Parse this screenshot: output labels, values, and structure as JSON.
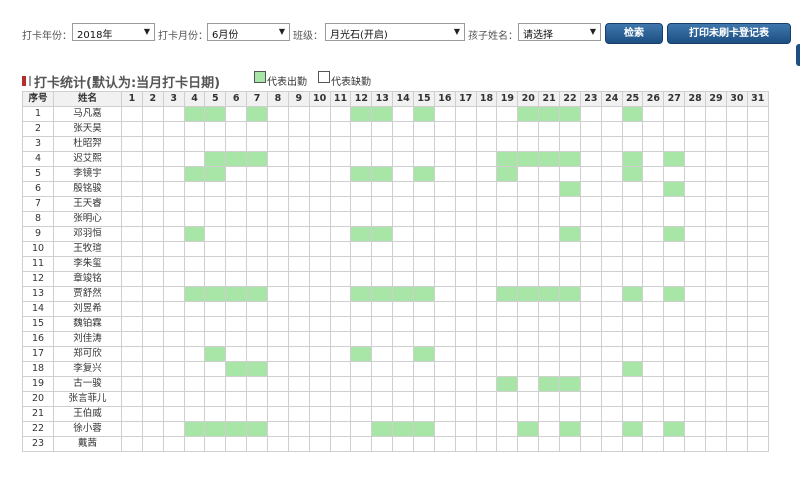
{
  "toolbar": {
    "year_label": "打卡年份：",
    "year_value": "2018年",
    "month_label": "打卡月份：",
    "month_value": "6月份",
    "class_label": "班级：",
    "class_value": "月光石(开启)",
    "child_label": "孩子姓名：",
    "child_value": "请选择",
    "search_button": "检索",
    "print_button": "打印未刷卡登记表"
  },
  "section": {
    "title": "打卡统计(默认为:当月打卡日期)",
    "legend_present": "代表出勤",
    "legend_absent": "代表缺勤",
    "present_color": "#a8e6a8",
    "absent_color": "#ffffff"
  },
  "table": {
    "header_no": "序号",
    "header_name": "姓名",
    "days": [
      "1",
      "2",
      "3",
      "4",
      "5",
      "6",
      "7",
      "8",
      "9",
      "10",
      "11",
      "12",
      "13",
      "14",
      "15",
      "16",
      "17",
      "18",
      "19",
      "20",
      "21",
      "22",
      "23",
      "24",
      "25",
      "26",
      "27",
      "28",
      "29",
      "30",
      "31"
    ],
    "rows": [
      {
        "no": "1",
        "name": "马凡嘉",
        "present": [
          4,
          5,
          7,
          12,
          13,
          15,
          20,
          21,
          22,
          25
        ]
      },
      {
        "no": "2",
        "name": "张天昊",
        "present": []
      },
      {
        "no": "3",
        "name": "杜昭羿",
        "present": []
      },
      {
        "no": "4",
        "name": "迟艾熙",
        "present": [
          5,
          6,
          7,
          19,
          20,
          21,
          22,
          25,
          27
        ]
      },
      {
        "no": "5",
        "name": "李镜宇",
        "present": [
          4,
          5,
          12,
          13,
          15,
          19,
          25
        ]
      },
      {
        "no": "6",
        "name": "殷铭骏",
        "present": [
          22,
          27
        ]
      },
      {
        "no": "7",
        "name": "王天睿",
        "present": []
      },
      {
        "no": "8",
        "name": "张明心",
        "present": []
      },
      {
        "no": "9",
        "name": "邓羽恒",
        "present": [
          4,
          12,
          13,
          22,
          27
        ]
      },
      {
        "no": "10",
        "name": "王牧瑄",
        "present": []
      },
      {
        "no": "11",
        "name": "李朱玺",
        "present": []
      },
      {
        "no": "12",
        "name": "章竣铭",
        "present": []
      },
      {
        "no": "13",
        "name": "贾舒然",
        "present": [
          4,
          5,
          6,
          7,
          12,
          13,
          14,
          15,
          19,
          20,
          21,
          22,
          25,
          27
        ]
      },
      {
        "no": "14",
        "name": "刘昱希",
        "present": []
      },
      {
        "no": "15",
        "name": "魏铂霖",
        "present": []
      },
      {
        "no": "16",
        "name": "刘佳涛",
        "present": []
      },
      {
        "no": "17",
        "name": "郑可欣",
        "present": [
          5,
          12,
          15
        ]
      },
      {
        "no": "18",
        "name": "李复兴",
        "present": [
          6,
          7,
          25
        ]
      },
      {
        "no": "19",
        "name": "古一骏",
        "present": [
          19,
          21,
          22
        ]
      },
      {
        "no": "20",
        "name": "张言菲儿",
        "present": []
      },
      {
        "no": "21",
        "name": "王伯威",
        "present": []
      },
      {
        "no": "22",
        "name": "徐小蓉",
        "present": [
          4,
          5,
          6,
          7,
          13,
          14,
          15,
          20,
          22,
          25,
          27
        ]
      },
      {
        "no": "23",
        "name": "戴茜",
        "present": []
      }
    ]
  }
}
